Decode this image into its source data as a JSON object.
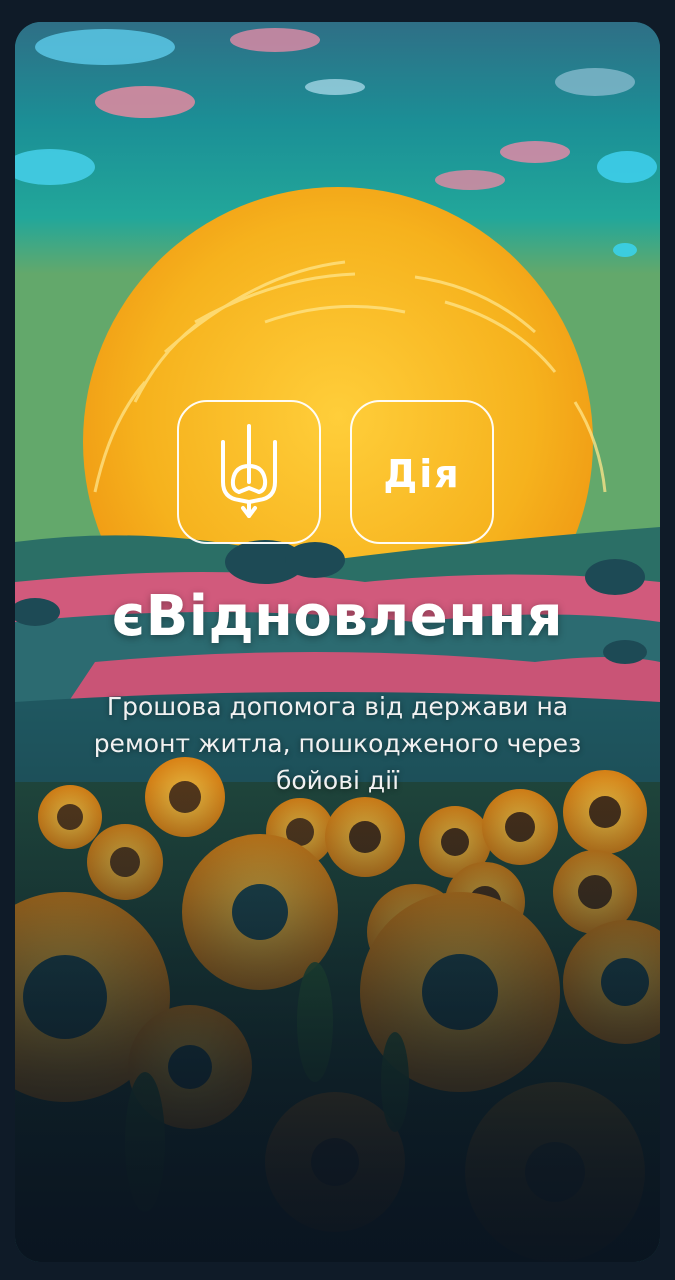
{
  "header": {
    "title": "єВідновлення",
    "subtitle": "Грошова допомога від держави на ремонт житла, пошкодженого через бойові дії"
  },
  "logos": {
    "emblem_icon": "tryzub-icon",
    "app_logo_text": "Дія"
  },
  "colors": {
    "sky_top": "#3a8a9a",
    "sky_mid": "#19a6a6",
    "sun": "#f5b21c",
    "field_pink": "#d9557a",
    "sunflower_petal": "#f2a623",
    "sunflower_center": "#1f4a52",
    "text": "#ffffff"
  }
}
